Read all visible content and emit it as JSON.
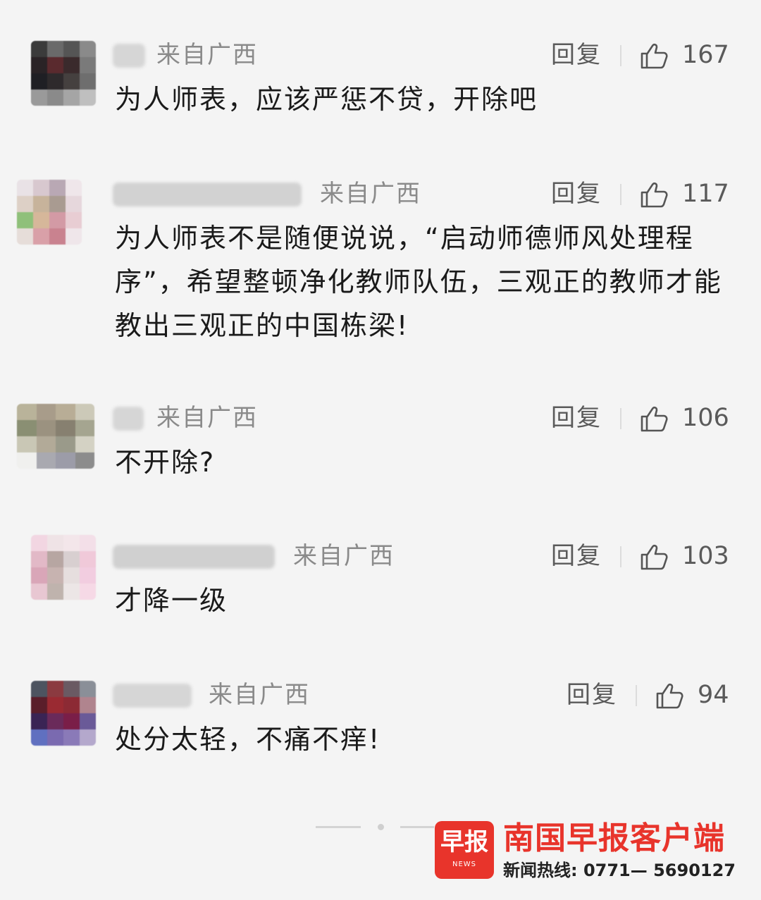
{
  "comments": [
    {
      "location": "来自广西",
      "reply_label": "回复",
      "likes": "167",
      "text": "为人师表，应该严惩不贷，开除吧"
    },
    {
      "location": "来自广西",
      "reply_label": "回复",
      "likes": "117",
      "text": "为人师表不是随便说说，“启动师德师风处理程序”，希望整顿净化教师队伍，三观正的教师才能教出三观正的中国栋梁!"
    },
    {
      "location": "来自广西",
      "reply_label": "回复",
      "likes": "106",
      "text": "不开除?"
    },
    {
      "location": "来自广西",
      "reply_label": "回复",
      "likes": "103",
      "text": "才降一级"
    },
    {
      "location": "来自广西",
      "reply_label": "回复",
      "likes": "94",
      "text": "处分太轻，不痛不痒!"
    }
  ],
  "watermark": {
    "logo_text": "早报",
    "logo_sub": "NEWS",
    "name": "南国早报客户端",
    "hotline": "新闻热线: 0771— 5690127"
  },
  "colors": {
    "brand": "#e8342b",
    "background": "#f4f4f4",
    "text": "#1a1a1a",
    "meta": "#8a8a8a"
  }
}
